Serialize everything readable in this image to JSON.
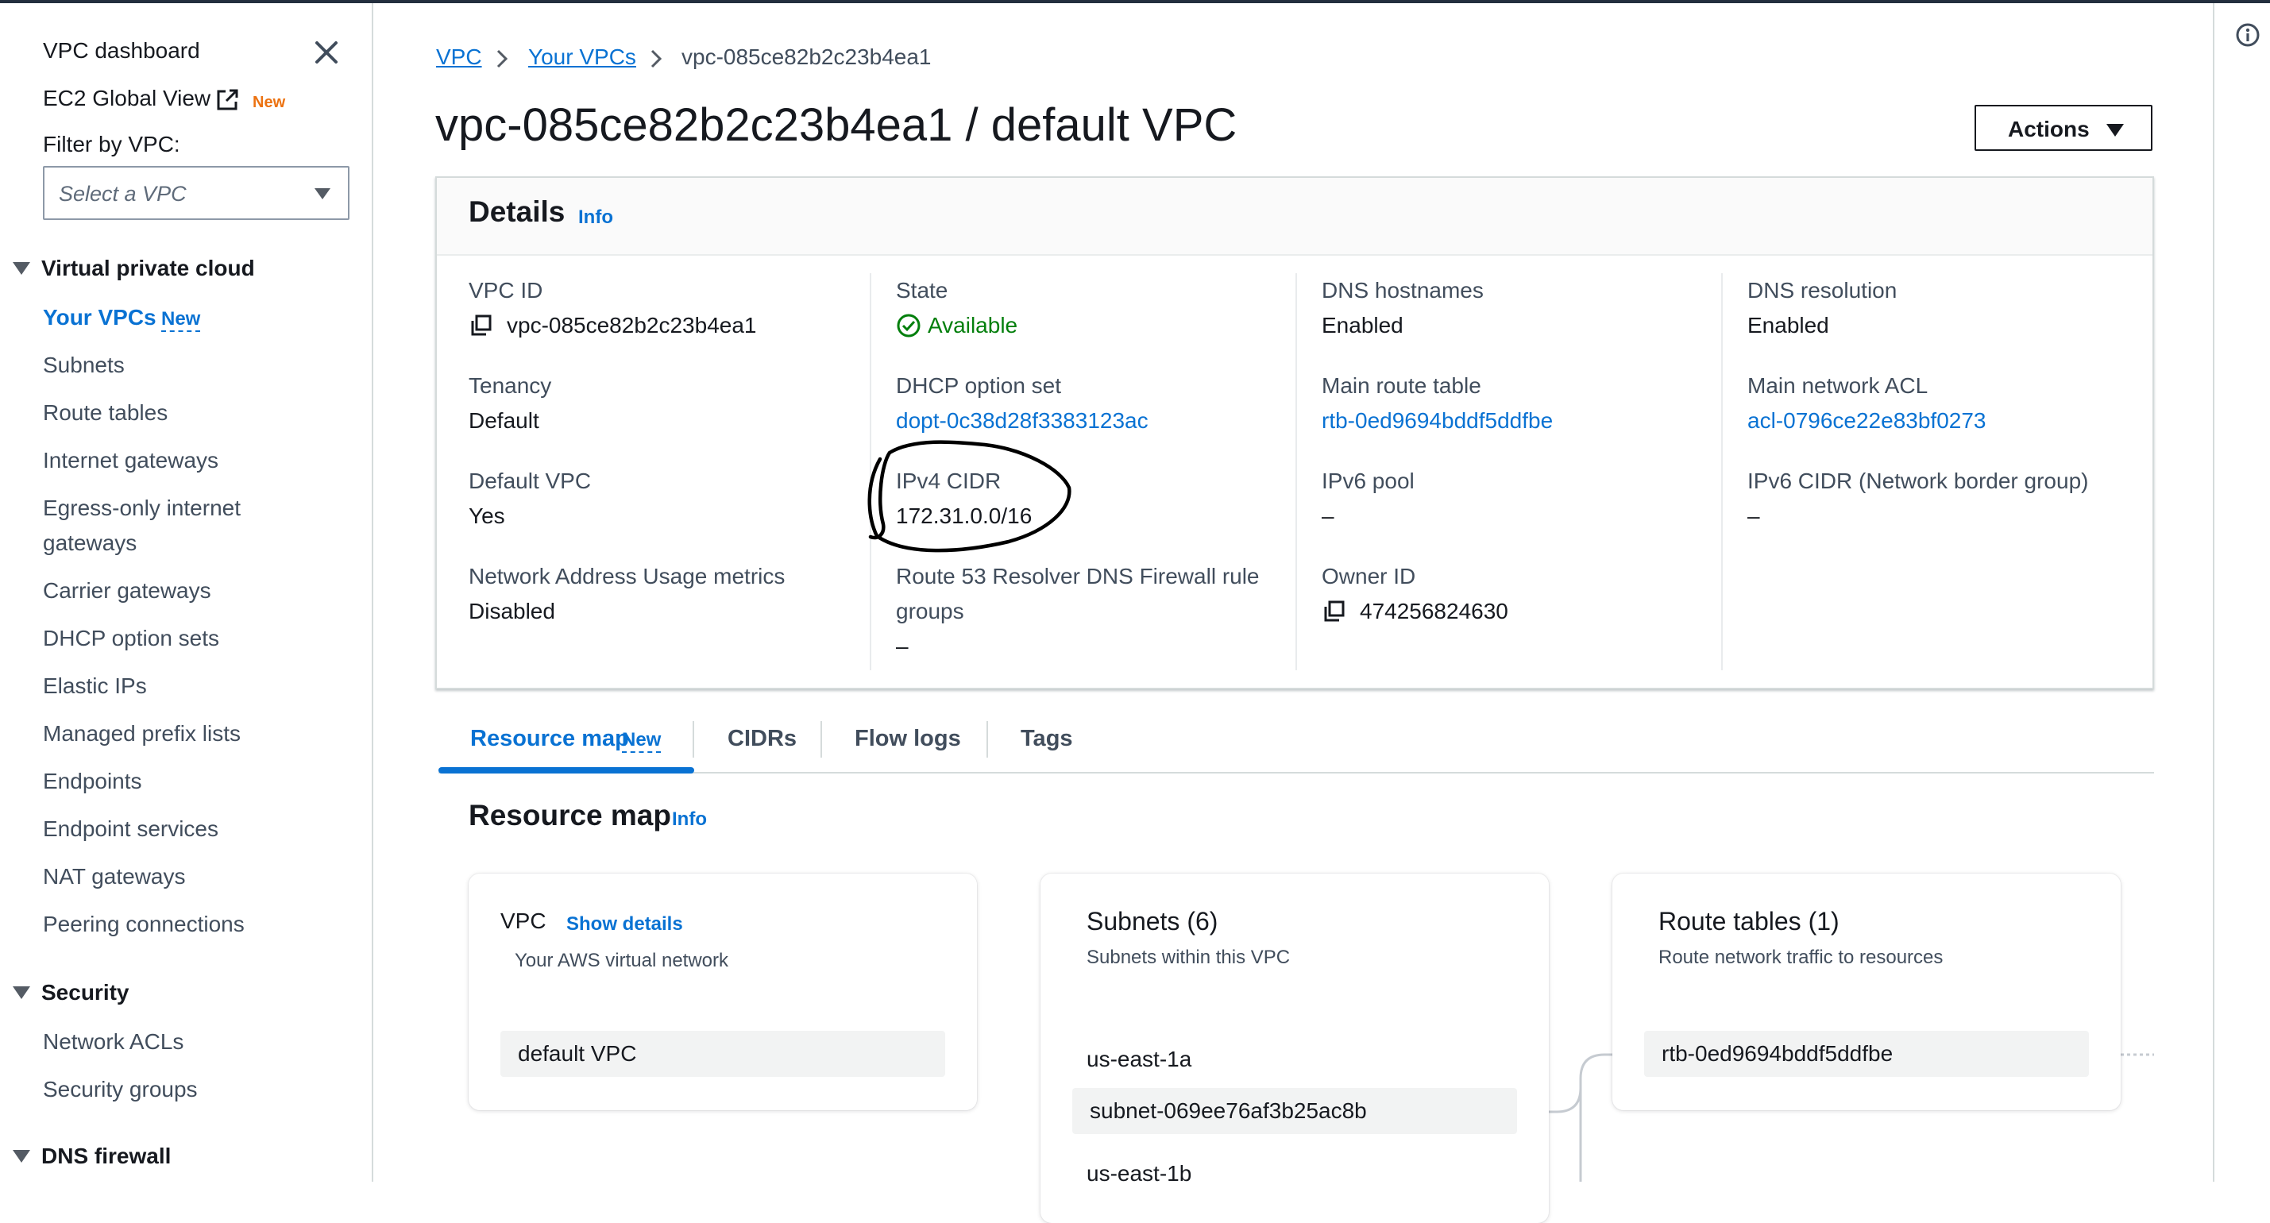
{
  "sidebar": {
    "dashboard": "VPC dashboard",
    "global_view": "EC2 Global View",
    "global_view_badge": "New",
    "filter_label": "Filter by VPC:",
    "filter_placeholder": "Select a VPC",
    "sections": [
      {
        "title": "Virtual private cloud",
        "items": [
          {
            "label": "Your VPCs",
            "badge": "New",
            "active": true
          },
          {
            "label": "Subnets"
          },
          {
            "label": "Route tables"
          },
          {
            "label": "Internet gateways"
          },
          {
            "label": "Egress-only internet"
          },
          {
            "label": "gateways"
          },
          {
            "label": "Carrier gateways"
          },
          {
            "label": "DHCP option sets"
          },
          {
            "label": "Elastic IPs"
          },
          {
            "label": "Managed prefix lists"
          },
          {
            "label": "Endpoints"
          },
          {
            "label": "Endpoint services"
          },
          {
            "label": "NAT gateways"
          },
          {
            "label": "Peering connections"
          }
        ]
      },
      {
        "title": "Security",
        "items": [
          {
            "label": "Network ACLs"
          },
          {
            "label": "Security groups"
          }
        ]
      },
      {
        "title": "DNS firewall",
        "items": []
      }
    ]
  },
  "breadcrumb": [
    "VPC",
    "Your VPCs",
    "vpc-085ce82b2c23b4ea1"
  ],
  "page_title": "vpc-085ce82b2c23b4ea1 / default VPC",
  "actions_label": "Actions",
  "details": {
    "title": "Details",
    "info": "Info",
    "fields": {
      "vpc_id": {
        "label": "VPC ID",
        "value": "vpc-085ce82b2c23b4ea1"
      },
      "state": {
        "label": "State",
        "value": "Available"
      },
      "dns_hostnames": {
        "label": "DNS hostnames",
        "value": "Enabled"
      },
      "dns_resolution": {
        "label": "DNS resolution",
        "value": "Enabled"
      },
      "tenancy": {
        "label": "Tenancy",
        "value": "Default"
      },
      "dhcp": {
        "label": "DHCP option set",
        "value": "dopt-0c38d28f3383123ac"
      },
      "main_route_table": {
        "label": "Main route table",
        "value": "rtb-0ed9694bddf5ddfbe"
      },
      "main_acl": {
        "label": "Main network ACL",
        "value": "acl-0796ce22e83bf0273"
      },
      "default_vpc": {
        "label": "Default VPC",
        "value": "Yes"
      },
      "ipv4_cidr": {
        "label": "IPv4 CIDR",
        "value": "172.31.0.0/16"
      },
      "ipv6_pool": {
        "label": "IPv6 pool",
        "value": "–"
      },
      "ipv6_cidr": {
        "label": "IPv6 CIDR (Network border group)",
        "value": "–"
      },
      "nau_metrics": {
        "label": "Network Address Usage metrics",
        "value": "Disabled"
      },
      "route53": {
        "label_line1": "Route 53 Resolver DNS Firewall rule",
        "label_line2": "groups",
        "value": "–"
      },
      "owner_id": {
        "label": "Owner ID",
        "value": "474256824630"
      }
    }
  },
  "tabs": [
    {
      "label": "Resource map",
      "badge": "New",
      "active": true
    },
    {
      "label": "CIDRs"
    },
    {
      "label": "Flow logs"
    },
    {
      "label": "Tags"
    }
  ],
  "resource_map": {
    "title": "Resource map",
    "info": "Info",
    "vpc_card": {
      "title": "VPC",
      "link": "Show details",
      "subtitle": "Your AWS virtual network",
      "item": "default VPC"
    },
    "subnets_card": {
      "title": "Subnets (6)",
      "subtitle": "Subnets within this VPC",
      "groups": [
        {
          "az": "us-east-1a",
          "subnet": "subnet-069ee76af3b25ac8b"
        },
        {
          "az": "us-east-1b"
        }
      ]
    },
    "routes_card": {
      "title": "Route tables (1)",
      "subtitle": "Route network traffic to resources",
      "item": "rtb-0ed9694bddf5ddfbe"
    }
  },
  "colors": {
    "link": "#0972d3",
    "success": "#037f0c",
    "new_badge_orange": "#ec7211",
    "text": "#16191f"
  }
}
